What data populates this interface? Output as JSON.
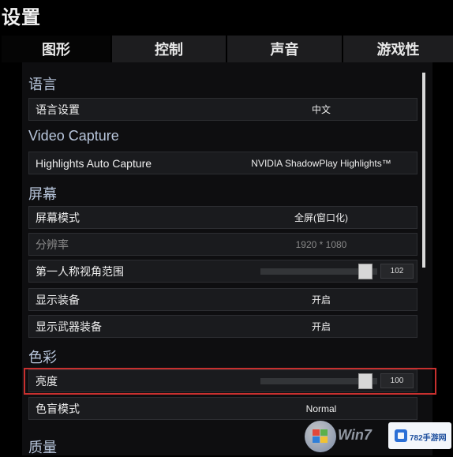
{
  "header": {
    "title": "设置"
  },
  "tabs": [
    {
      "label": "图形",
      "active": true
    },
    {
      "label": "控制",
      "active": false
    },
    {
      "label": "声音",
      "active": false
    },
    {
      "label": "游戏性",
      "active": false
    }
  ],
  "sections": {
    "language": "语言",
    "video_capture": "Video Capture",
    "screen": "屏幕",
    "color": "色彩",
    "quality": "质量"
  },
  "settings": {
    "language": {
      "label": "语言设置",
      "value": "中文"
    },
    "highlights": {
      "label": "Highlights Auto Capture",
      "value": "NVIDIA ShadowPlay Highlights™"
    },
    "screen_mode": {
      "label": "屏幕模式",
      "value": "全屏(窗口化)"
    },
    "resolution": {
      "label": "分辨率",
      "value": "1920 * 1080",
      "disabled": true
    },
    "fov": {
      "label": "第一人称视角范围",
      "value": "102",
      "slider_fraction": 0.95
    },
    "show_equipment": {
      "label": "显示装备",
      "value": "开启"
    },
    "show_weapon_equipment": {
      "label": "显示武器装备",
      "value": "开启"
    },
    "brightness": {
      "label": "亮度",
      "value": "100",
      "slider_fraction": 0.95
    },
    "colorblind_mode": {
      "label": "色盲模式",
      "value": "Normal"
    }
  },
  "watermarks": {
    "win7": "Win7",
    "site": "782手游网"
  },
  "colors": {
    "highlight_border": "#c8302f",
    "section_text": "#b8c6dc"
  }
}
